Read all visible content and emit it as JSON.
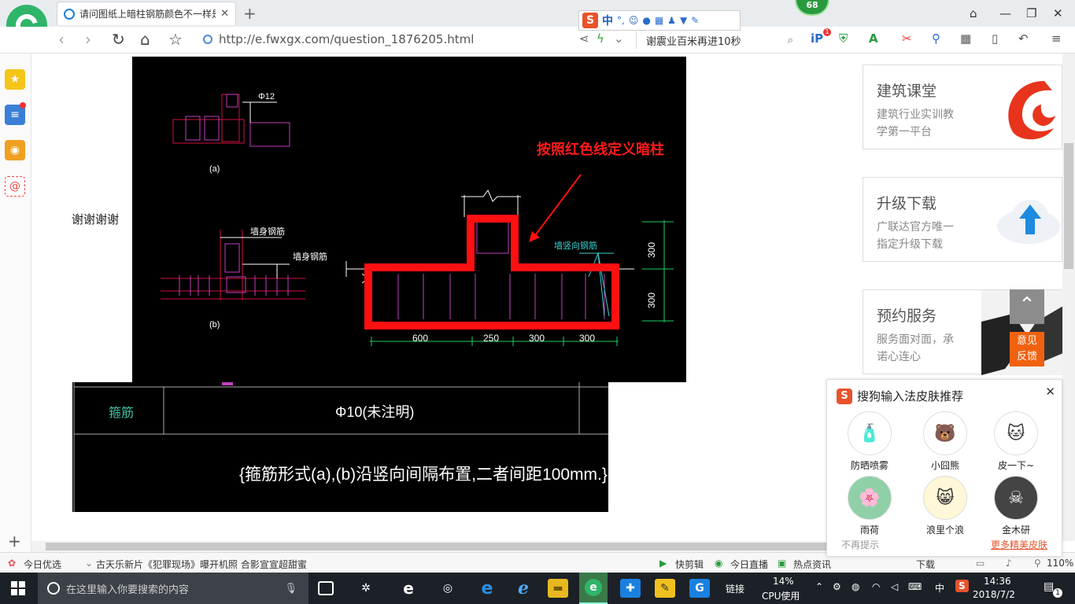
{
  "browser": {
    "tab_title": "请问图纸上暗柱钢筋颜色不一样是",
    "url": "http://e.fwxgx.com/question_1876205.html",
    "search_text": "谢震业百米再进10秒",
    "badge_count": "68",
    "ext_badge": "1"
  },
  "ime_toolbar": {
    "logo": "S",
    "mode": "中",
    "punct": "°,"
  },
  "page": {
    "thanks_text": "谢谢谢谢",
    "cad_annotation": "按照红色线定义暗柱",
    "cad_labels": {
      "phi12": "Φ12",
      "fig_a": "(a)",
      "fig_b": "(b)",
      "wall_rebar_1": "墙身钢筋",
      "wall_rebar_2": "墙身钢筋",
      "wall_vertical_rebar": "墙竖向钢筋",
      "dim_600": "600",
      "dim_250": "250",
      "dim_300a": "300",
      "dim_300b": "300",
      "dim_v_300a": "300",
      "dim_v_300b": "300"
    },
    "cad_table": {
      "row_label": "箍筋",
      "row_value": "Φ10(未注明)",
      "note": "{箍筋形式(a),(b)沿竖向间隔布置,二者间距100mm.}"
    }
  },
  "right_ads": [
    {
      "title": "建筑课堂",
      "line1": "建筑行业实训教",
      "line2": "学第一平台"
    },
    {
      "title": "升级下载",
      "line1": "广联达官方唯一",
      "line2": "指定升级下载"
    },
    {
      "title": "预约服务",
      "line1": "服务面对面，承",
      "line2": "诺心连心"
    }
  ],
  "feedback": {
    "line1": "意见",
    "line2": "反馈"
  },
  "sogou_popup": {
    "title": "搜狗输入法皮肤推荐",
    "skins": [
      {
        "name": "防晒喷雾"
      },
      {
        "name": "小囧熊"
      },
      {
        "name": "皮一下~"
      },
      {
        "name": "雨荷"
      },
      {
        "name": "浪里个浪"
      },
      {
        "name": "金木研"
      }
    ],
    "no_remind": "不再提示",
    "more": "更多精美皮肤"
  },
  "status_bar": {
    "today_pick": "今日优选",
    "news": "古天乐新片《犯罪现场》曝开机照 合影宣宣超甜蜜",
    "quick_clip": "快剪辑",
    "live": "今日直播",
    "hot_news": "热点资讯",
    "download": "下载",
    "zoom": "110%"
  },
  "taskbar": {
    "search_placeholder": "在这里输入你要搜索的内容",
    "link_label": "链接",
    "cpu_percent": "14%",
    "cpu_label": "CPU使用",
    "ime_lang": "中",
    "time": "14:36",
    "date": "2018/7/2",
    "notif_count": "1"
  }
}
